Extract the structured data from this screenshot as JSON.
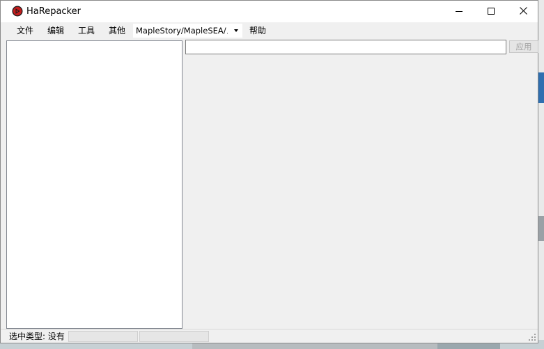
{
  "window": {
    "title": "HaRepacker",
    "accent_color": "#c41e1e"
  },
  "titlebar_buttons": {
    "minimize_icon": "minimize-icon",
    "maximize_icon": "maximize-icon",
    "close_icon": "close-icon"
  },
  "menu": {
    "file": "文件",
    "edit": "编辑",
    "tools": "工具",
    "other": "其他",
    "version_selected": "MapleStory/MapleSEA/メイプル",
    "help": "帮助"
  },
  "search": {
    "value": "",
    "placeholder": ""
  },
  "apply_button": {
    "label": "应用"
  },
  "statusbar": {
    "selection_type": "选中类型: 没有"
  }
}
